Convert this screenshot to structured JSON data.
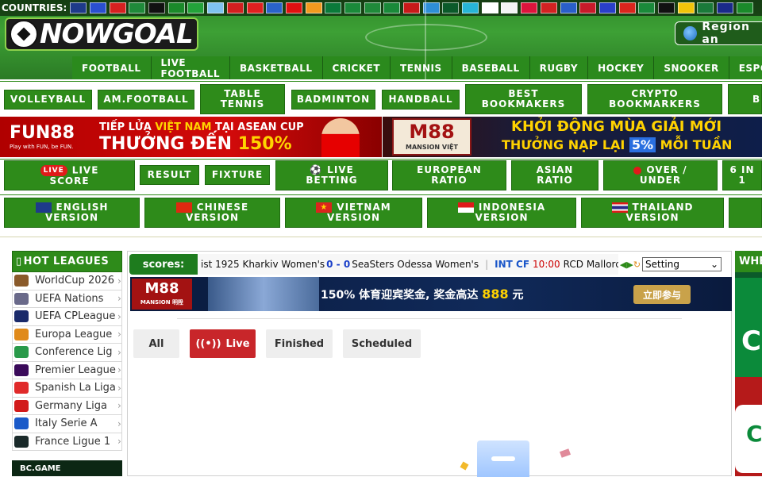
{
  "header": {
    "countries_label": "COUNTRIES:",
    "flags": [
      {
        "name": "uk-flag-icon",
        "color": "#1e3a8a"
      },
      {
        "name": "france-flag-icon",
        "color": "#2a4fd0"
      },
      {
        "name": "spain-flag-icon",
        "color": "#d62020"
      },
      {
        "name": "italy-flag-icon",
        "color": "#1f8a3a"
      },
      {
        "name": "germany-flag-icon",
        "color": "#111111"
      },
      {
        "name": "portugal-flag-icon",
        "color": "#1a8a2a"
      },
      {
        "name": "brazil-flag-icon",
        "color": "#23a33a"
      },
      {
        "name": "argentina-flag-icon",
        "color": "#7fc3f0"
      },
      {
        "name": "peru-flag-icon",
        "color": "#d21f1f"
      },
      {
        "name": "chile-flag-icon",
        "color": "#e02020"
      },
      {
        "name": "greece-flag-icon",
        "color": "#2a63c9"
      },
      {
        "name": "turkey-flag-icon",
        "color": "#e01010"
      },
      {
        "name": "india-flag-icon",
        "color": "#f29a1f"
      },
      {
        "name": "bangladesh-flag-icon",
        "color": "#0a7a3a"
      },
      {
        "name": "saudi-flag-icon",
        "color": "#1a8a3a"
      },
      {
        "name": "uae-flag-icon",
        "color": "#1f8a3a"
      },
      {
        "name": "kuwait-flag-icon",
        "color": "#1a8a3a"
      },
      {
        "name": "morocco-flag-icon",
        "color": "#c81a1a"
      },
      {
        "name": "azerbaijan-flag-icon",
        "color": "#2e8fd6"
      },
      {
        "name": "pakistan-flag-icon",
        "color": "#0b5a2a"
      },
      {
        "name": "kazakhstan-flag-icon",
        "color": "#27b5d6"
      },
      {
        "name": "japan-flag-icon",
        "color": "#ffffff"
      },
      {
        "name": "korea-flag-icon",
        "color": "#f4f4f4"
      },
      {
        "name": "poland-flag-icon",
        "color": "#dc143c"
      },
      {
        "name": "czech-flag-icon",
        "color": "#d22222"
      },
      {
        "name": "estonia-flag-icon",
        "color": "#2a5fc9"
      },
      {
        "name": "norway-flag-icon",
        "color": "#c81a2a"
      },
      {
        "name": "russia-flag-icon",
        "color": "#2a3fc9"
      },
      {
        "name": "vietnam-flag-icon",
        "color": "#da251d"
      },
      {
        "name": "nigeria-flag-icon",
        "color": "#1a8a3a"
      },
      {
        "name": "kenya-flag-icon",
        "color": "#111111"
      },
      {
        "name": "uganda-flag-icon",
        "color": "#f2c40a"
      },
      {
        "name": "south-africa-flag-icon",
        "color": "#1a7a3a"
      },
      {
        "name": "australia-flag-icon",
        "color": "#1a2a8a"
      },
      {
        "name": "zimbabwe-flag-icon",
        "color": "#1a8a2a"
      }
    ],
    "logo_text": "NOWGOAL",
    "region_label": "Region an",
    "nav": [
      "FOOTBALL",
      "LIVE FOOTBALL",
      "BASKETBALL",
      "CRICKET",
      "TENNIS",
      "BASEBALL",
      "RUGBY",
      "HOCKEY",
      "SNOOKER",
      "ESPORTS"
    ]
  },
  "row2": {
    "volleyball": "VOLLEYBALL",
    "am_football": "AM.FOOTBALL",
    "table_tennis_1": "TABLE",
    "table_tennis_2": "TENNIS",
    "badminton": "BADMINTON",
    "handball": "HANDBALL",
    "best_1": "BEST",
    "best_2": "BOOKMAKERS",
    "crypto_1": "CRYPTO",
    "crypto_2": "BOOKMARKERS",
    "cut": "B"
  },
  "banners": {
    "fun88_logo": "FUN88",
    "fun88_tagline": "Play with FUN, be FUN.",
    "fun88_line1_a": "TIẾP LỬA ",
    "fun88_line1_b": "VIỆT NAM",
    "fun88_line1_c": " TẠI ASEAN CUP",
    "fun88_line2_a": "THƯỞNG ĐẾN ",
    "fun88_line2_b": "150%",
    "m88_logo": "M88",
    "m88_sub": "MANSION VIỆT",
    "m88_line1": "KHỞI ĐỘNG MÙA GIẢI MỚI",
    "m88_line2_a": "THƯỞNG NẠP LẠI ",
    "m88_line2_b": "5%",
    "m88_line2_c": " MỖI TUẦN"
  },
  "row3": {
    "live_badge": "LIVE",
    "live_score_1": "LIVE",
    "live_score_2": "SCORE",
    "result": "RESULT",
    "fixture": "FIXTURE",
    "live_betting_1": "LIVE",
    "live_betting_2": "BETTING",
    "european_1": "EUROPEAN",
    "european_2": "RATIO",
    "asian_1": "ASIAN",
    "asian_2": "RATIO",
    "over_1": "OVER /",
    "over_2": "UNDER",
    "six_1": "6 IN",
    "six_2": "1"
  },
  "row4": {
    "english_1": "ENGLISH",
    "english_2": "VERSION",
    "chinese_1": "CHINESE",
    "chinese_2": "VERSION",
    "vietnam_1": "VIETNAM",
    "vietnam_2": "VERSION",
    "indonesia_1": "INDONESIA",
    "indonesia_2": "VERSION",
    "thailand_1": "THAILAND",
    "thailand_2": "VERSION"
  },
  "sidebar": {
    "title": "HOT LEAGUES",
    "items": [
      {
        "label": "WorldCup 2026",
        "color": "#8a5a2a"
      },
      {
        "label": "UEFA Nations",
        "color": "#6a6a8a"
      },
      {
        "label": "UEFA CPLeague",
        "color": "#1a2a6a"
      },
      {
        "label": "Europa League",
        "color": "#e08a1a"
      },
      {
        "label": "Conference Lig",
        "color": "#2a9a4a"
      },
      {
        "label": "Premier League",
        "color": "#3a0a5a"
      },
      {
        "label": "Spanish La Liga",
        "color": "#e02a2a"
      },
      {
        "label": "Germany Liga",
        "color": "#d21a1a"
      },
      {
        "label": "Italy Serie A",
        "color": "#1a5ac9"
      },
      {
        "label": "France Ligue 1",
        "color": "#1a2a2a"
      }
    ],
    "bc_game": "BC.GAME"
  },
  "main": {
    "scores_label": "scores:",
    "ticker": {
      "home1": "ist 1925 Kharkiv Women's",
      "score1": "0 - 0",
      "away1": "SeaSters Odessa Women's",
      "league2": "INT CF",
      "time2": "10:00",
      "home2": "RCD Mallorca"
    },
    "setting_label": "Setting",
    "ad": {
      "logo": "M88",
      "logo_sub": "MANSION 明陞",
      "text_a": "150% 体育迎宾奖金, 奖金高达 ",
      "text_b": "888",
      "text_c": " 元",
      "cta": "立即参与"
    },
    "tabs": [
      {
        "label": "All",
        "active": false
      },
      {
        "label": "Live",
        "active": true
      },
      {
        "label": "Finished",
        "active": false
      },
      {
        "label": "Scheduled",
        "active": false
      }
    ]
  },
  "right": {
    "title": "WHE",
    "ad_letter_1": "C",
    "ad_letter_2": "C"
  }
}
